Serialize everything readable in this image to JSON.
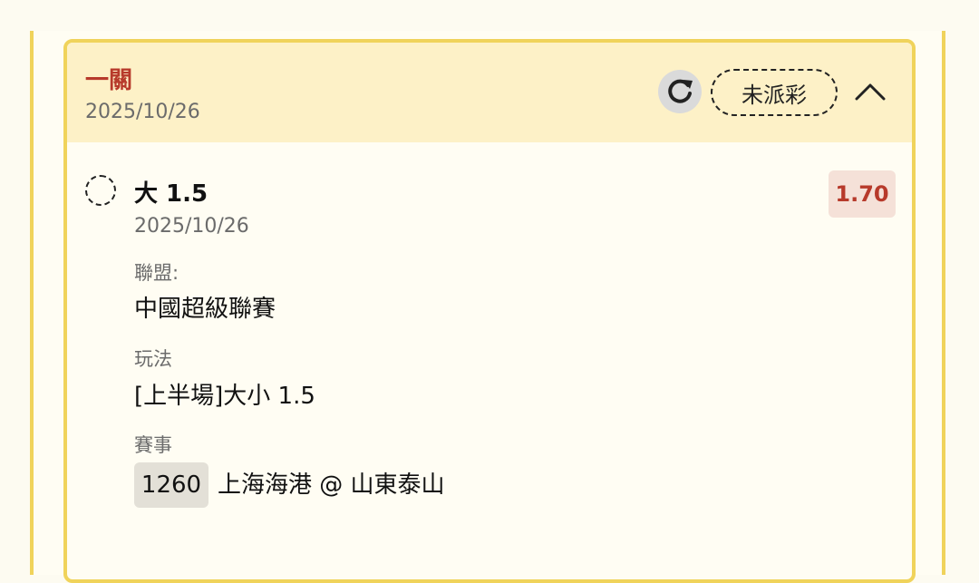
{
  "bet": {
    "type": "一關",
    "date": "2025/10/26",
    "status": "未派彩"
  },
  "selection": {
    "name": "大 1.5",
    "date": "2025/10/26",
    "odds": "1.70"
  },
  "details": {
    "league_label": "聯盟:",
    "league_value": "中國超級聯賽",
    "market_label": "玩法",
    "market_value": "[上半場]大小 1.5",
    "match_label": "賽事",
    "match_no": "1260",
    "match_name": "上海海港 @ 山東泰山"
  },
  "colors": {
    "accent_red": "#b73a2b",
    "border_yellow": "#f0d35b",
    "header_bg": "#fdf1c7"
  },
  "icons": {
    "refresh": "refresh-icon",
    "collapse": "chevron-up-icon",
    "radio": "dashed-circle-icon"
  }
}
